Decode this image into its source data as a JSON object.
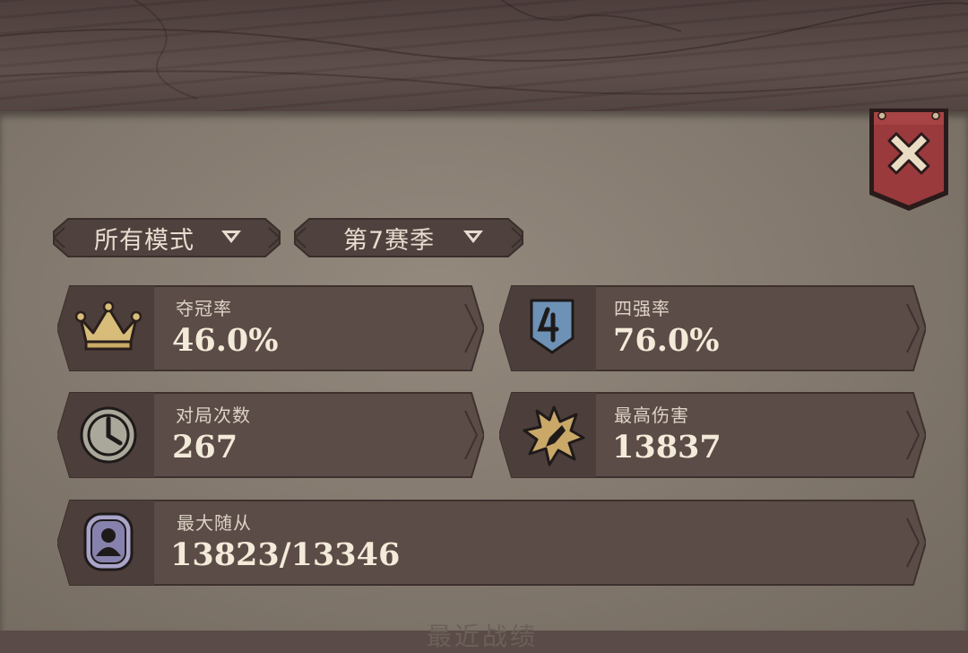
{
  "filters": {
    "mode_label": "所有模式",
    "season_label": "第7赛季"
  },
  "stats": {
    "win_rate": {
      "title": "夺冠率",
      "value": "46.0%",
      "icon": "crown-icon"
    },
    "top4_rate": {
      "title": "四强率",
      "value": "76.0%",
      "icon": "top4-badge-icon"
    },
    "games_played": {
      "title": "对局次数",
      "value": "267",
      "icon": "clock-icon"
    },
    "max_damage": {
      "title": "最高伤害",
      "value": "13837",
      "icon": "damage-burst-icon"
    },
    "max_minion": {
      "title": "最大随从",
      "value": "13823/13346",
      "icon": "minion-portrait-icon"
    }
  },
  "footer": {
    "recent_results_label": "最近战绩"
  },
  "colors": {
    "panel": "#857b70",
    "card": "#5b4c47",
    "card_icon_area": "#4c3e3a",
    "close_banner": "#9a3a3c",
    "value_text": "#f4ead9"
  }
}
